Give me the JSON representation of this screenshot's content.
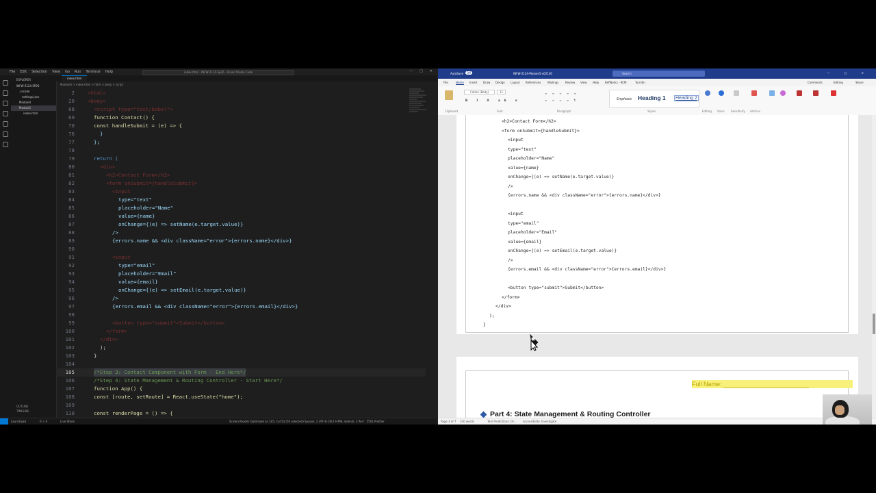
{
  "vscode": {
    "menu": [
      "File",
      "Edit",
      "Selection",
      "View",
      "Go",
      "Run",
      "Terminal",
      "Help"
    ],
    "command_center": "index.html - INFW-2124-Sp26 - Visual Studio Code",
    "explorer": {
      "title": "EXPLORER",
      "project": "INFW-2124-SP26",
      "items": [
        ".vscode",
        "settings.json",
        "Module4",
        "Module5",
        "index.html"
      ],
      "bottom": [
        "OUTLINE",
        "TIMELINE"
      ]
    },
    "tab": "index.html",
    "breadcrumb": "Module5 > index.html > html > body > script",
    "code": [
      {
        "n": "2",
        "c": "<html>"
      },
      {
        "n": "20",
        "c": "<body>"
      },
      {
        "n": "68",
        "c": "<script type=\"text/babel\">"
      },
      {
        "n": "69",
        "c": "function Contact() {"
      },
      {
        "n": "70",
        "c": "const handleSubmit = (e) => {"
      },
      {
        "n": "76",
        "c": "}"
      },
      {
        "n": "77",
        "c": "};"
      },
      {
        "n": "78",
        "c": ""
      },
      {
        "n": "79",
        "c": "return ("
      },
      {
        "n": "80",
        "c": "<div>"
      },
      {
        "n": "81",
        "c": "<h2>Contact Form</h2>"
      },
      {
        "n": "82",
        "c": "<form onSubmit={handleSubmit}>"
      },
      {
        "n": "83",
        "c": "<input"
      },
      {
        "n": "84",
        "c": "type=\"text\""
      },
      {
        "n": "85",
        "c": "placeholder=\"Name\""
      },
      {
        "n": "86",
        "c": "value={name}"
      },
      {
        "n": "87",
        "c": "onChange={(e) => setName(e.target.value)}"
      },
      {
        "n": "88",
        "c": "/>"
      },
      {
        "n": "89",
        "c": "{errors.name && <div className=\"error\">{errors.name}</div>}"
      },
      {
        "n": "90",
        "c": ""
      },
      {
        "n": "91",
        "c": "<input"
      },
      {
        "n": "92",
        "c": "type=\"email\""
      },
      {
        "n": "93",
        "c": "placeholder=\"Email\""
      },
      {
        "n": "94",
        "c": "value={email}"
      },
      {
        "n": "95",
        "c": "onChange={(e) => setEmail(e.target.value)}"
      },
      {
        "n": "96",
        "c": "/>"
      },
      {
        "n": "97",
        "c": "{errors.email && <div className=\"error\">{errors.email}</div>}"
      },
      {
        "n": "98",
        "c": ""
      },
      {
        "n": "99",
        "c": "<button type=\"submit\">Submit</button>"
      },
      {
        "n": "100",
        "c": "</form>"
      },
      {
        "n": "101",
        "c": "</div>"
      },
      {
        "n": "102",
        "c": ");"
      },
      {
        "n": "103",
        "c": "}"
      },
      {
        "n": "104",
        "c": ""
      },
      {
        "n": "105",
        "c": "/*Step 3: Contact Component with Form - End Here*/"
      },
      {
        "n": "106",
        "c": "/*Step 4: State Management & Routing Controller - Start Here*/"
      },
      {
        "n": "107",
        "c": "function App() {"
      },
      {
        "n": "108",
        "c": "const [route, setRoute] = React.useState(\"home\");"
      },
      {
        "n": "109",
        "c": ""
      },
      {
        "n": "110",
        "c": "const renderPage = () => {"
      }
    ],
    "status": {
      "left": "Launchpad",
      "counts": "0 ⚠ 0",
      "live_share": "Live Share",
      "right": "Screen Reader Optimized   Ln 105, Col 53 (50 selected)   Spaces: 2   UTF-8   CRLF   HTML   Indents: 2   Port : 5501   Prettier"
    }
  },
  "word": {
    "title_left": "AutoSave",
    "title_toggle": "Off",
    "doc_name": "INFW-2124-Module5-v02126",
    "search": "Search",
    "tabs": [
      "File",
      "Home",
      "Insert",
      "Draw",
      "Design",
      "Layout",
      "References",
      "Mailings",
      "Review",
      "View",
      "Help",
      "RefWorks - RCM",
      "Turnitin"
    ],
    "active_tab": "Home",
    "right_buttons": [
      "Comments",
      "Editing",
      "Share"
    ],
    "font_name": "Calibri (Body)",
    "font_size": "11",
    "styles": [
      "Emphasis",
      "Heading 1",
      "Heading 2"
    ],
    "groups": [
      "Clipboard",
      "Font",
      "Paragraph",
      "Styles",
      "Editing",
      "Voice",
      "Sensitivity",
      "Add-ins"
    ],
    "code_lines": [
      "<h2>Contact Form</h2>",
      "<form onSubmit={handleSubmit}>",
      "  <input",
      "    type=\"text\"",
      "    placeholder=\"Name\"",
      "    value={name}",
      "    onChange={(e) => setName(e.target.value)}",
      "  />",
      "  {errors.name && <div className=\"error\">{errors.name}</div>}",
      "",
      "  <input",
      "    type=\"email\"",
      "    placeholder=\"Email\"",
      "    value={email}",
      "    onChange={(e) => setEmail(e.target.value)}",
      "  />",
      "  {errors.email && <div className=\"error\">{errors.email}</div>}",
      "",
      "  <button type=\"submit\">Submit</button>",
      "</form>",
      "</div>",
      ");",
      "}"
    ],
    "full_name_label": "Full Name: _________________________",
    "part_heading": "Part 4: State Management & Routing Controller",
    "status": {
      "page": "Page 3 of 7",
      "words": "330 words",
      "predictions": "Text Predictions: On",
      "accessibility": "Accessibility: Investigate"
    }
  }
}
